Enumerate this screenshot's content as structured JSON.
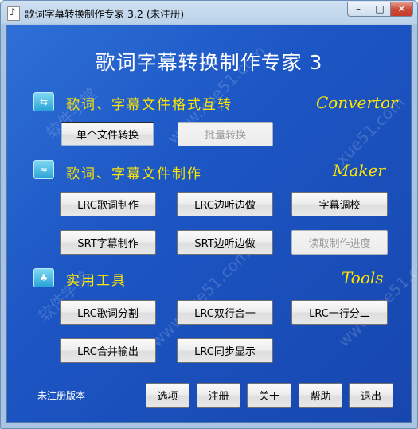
{
  "window": {
    "title": "歌词字幕转换制作专家 3.2 (未注册)"
  },
  "titlebar_buttons": {
    "minimize": "–",
    "maximize": "□",
    "close": "✕"
  },
  "main_title": "歌词字幕转换制作专家 3",
  "sections": {
    "convertor": {
      "title": "歌词、字幕文件格式互转",
      "eng": "Convertor",
      "icon": "convert-icon"
    },
    "maker": {
      "title": "歌词、字幕文件制作",
      "eng": "Maker",
      "icon": "maker-icon"
    },
    "tools": {
      "title": "实用工具",
      "eng": "Tools",
      "icon": "tree-icon"
    }
  },
  "buttons": {
    "single_convert": "单个文件转换",
    "batch_convert": "批量转换",
    "lrc_make": "LRC歌词制作",
    "lrc_listen": "LRC边听边做",
    "subtitle_adjust": "字幕调校",
    "srt_make": "SRT字幕制作",
    "srt_listen": "SRT边听边做",
    "read_progress": "读取制作进度",
    "lrc_split": "LRC歌词分割",
    "lrc_merge_two": "LRC双行合一",
    "lrc_one_to_two": "LRC一行分二",
    "lrc_merge_output": "LRC合并输出",
    "lrc_sync_display": "LRC同步显示"
  },
  "footer": {
    "unregistered": "未注册版本",
    "options": "选项",
    "register": "注册",
    "about": "关于",
    "help": "帮助",
    "exit": "退出"
  },
  "colors": {
    "client_bg": "#1c56c4",
    "section_text": "#ffe600",
    "title_text": "#ffffff"
  }
}
